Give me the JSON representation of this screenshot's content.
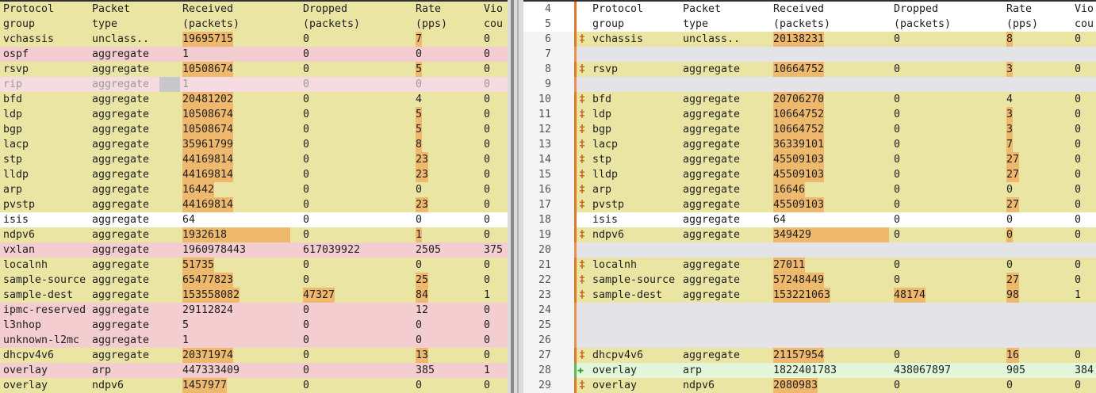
{
  "colors": {
    "yellow": "#ebe5a4",
    "pink": "#f4cdd0",
    "pink_light": "#f6dbe0",
    "white": "#ffffff",
    "grey": "#e3e3e8",
    "green": "#e2f7da",
    "highlight": "#eeb96c",
    "change_marker": "#e07a2b"
  },
  "icons": {
    "changed": "wavy-change-icon",
    "added": "plus-icon"
  },
  "headers": {
    "line1": [
      "Protocol",
      "Packet",
      "Received",
      "Dropped",
      "Rate",
      "Vio"
    ],
    "line2": [
      "group",
      "type",
      "(packets)",
      "(packets)",
      "(pps)",
      "cou"
    ]
  },
  "left": {
    "header_color": "yellow",
    "rows": [
      {
        "c": [
          "vchassis",
          "unclass..",
          "19695715",
          "0",
          "7",
          "0"
        ],
        "bg": "yellow",
        "hl": [
          2,
          4
        ]
      },
      {
        "c": [
          "ospf",
          "aggregate",
          "1",
          "0",
          "0",
          "0"
        ],
        "bg": "pink",
        "hl": []
      },
      {
        "c": [
          "rsvp",
          "aggregate",
          "10508674",
          "0",
          "5",
          "0"
        ],
        "bg": "yellow",
        "hl": [
          2,
          4
        ]
      },
      {
        "c": [
          "rip",
          "aggregate",
          "1",
          "0",
          "0",
          "0"
        ],
        "bg": "pink_light",
        "hl": [],
        "dim": true
      },
      {
        "c": [
          "bfd",
          "aggregate",
          "20481202",
          "0",
          "4",
          "0"
        ],
        "bg": "yellow",
        "hl": [
          2
        ]
      },
      {
        "c": [
          "ldp",
          "aggregate",
          "10508674",
          "0",
          "5",
          "0"
        ],
        "bg": "yellow",
        "hl": [
          2,
          4
        ]
      },
      {
        "c": [
          "bgp",
          "aggregate",
          "10508674",
          "0",
          "5",
          "0"
        ],
        "bg": "yellow",
        "hl": [
          2,
          4
        ]
      },
      {
        "c": [
          "lacp",
          "aggregate",
          "35961799",
          "0",
          "8",
          "0"
        ],
        "bg": "yellow",
        "hl": [
          2,
          4
        ]
      },
      {
        "c": [
          "stp",
          "aggregate",
          "44169814",
          "0",
          "23",
          "0"
        ],
        "bg": "yellow",
        "hl": [
          2,
          4
        ]
      },
      {
        "c": [
          "lldp",
          "aggregate",
          "44169814",
          "0",
          "23",
          "0"
        ],
        "bg": "yellow",
        "hl": [
          2,
          4
        ]
      },
      {
        "c": [
          "arp",
          "aggregate",
          "16442",
          "0",
          "0",
          "0"
        ],
        "bg": "yellow",
        "hl": [
          2
        ]
      },
      {
        "c": [
          "pvstp",
          "aggregate",
          "44169814",
          "0",
          "23",
          "0"
        ],
        "bg": "yellow",
        "hl": [
          2,
          4
        ]
      },
      {
        "c": [
          "isis",
          "aggregate",
          "64",
          "0",
          "0",
          "0"
        ],
        "bg": "white",
        "hl": []
      },
      {
        "c": [
          "ndpv6",
          "aggregate",
          "1932618",
          "0",
          "1",
          "0"
        ],
        "bg": "yellow",
        "hl": [
          2,
          4
        ]
      },
      {
        "c": [
          "vxlan",
          "aggregate",
          "1960978443",
          "617039922",
          "2505",
          "375"
        ],
        "bg": "pink",
        "hl": []
      },
      {
        "c": [
          "localnh",
          "aggregate",
          "51735",
          "0",
          "0",
          "0"
        ],
        "bg": "yellow",
        "hl": [
          2
        ]
      },
      {
        "c": [
          "sample-source",
          "aggregate",
          "65477823",
          "0",
          "25",
          "0"
        ],
        "bg": "yellow",
        "hl": [
          2,
          4
        ]
      },
      {
        "c": [
          "sample-dest",
          "aggregate",
          "153558082",
          "47327",
          "84",
          "1"
        ],
        "bg": "yellow",
        "hl": [
          2,
          3,
          4
        ]
      },
      {
        "c": [
          "ipmc-reserved",
          "aggregate",
          "29112824",
          "0",
          "12",
          "0"
        ],
        "bg": "pink",
        "hl": []
      },
      {
        "c": [
          "l3nhop",
          "aggregate",
          "5",
          "0",
          "0",
          "0"
        ],
        "bg": "pink",
        "hl": []
      },
      {
        "c": [
          "unknown-l2mc",
          "aggregate",
          "1",
          "0",
          "0",
          "0"
        ],
        "bg": "pink",
        "hl": []
      },
      {
        "c": [
          "dhcpv4v6",
          "aggregate",
          "20371974",
          "0",
          "13",
          "0"
        ],
        "bg": "yellow",
        "hl": [
          2,
          4
        ]
      },
      {
        "c": [
          "overlay",
          "arp",
          "447333409",
          "0",
          "385",
          "1"
        ],
        "bg": "pink",
        "hl": []
      },
      {
        "c": [
          "overlay",
          "ndpv6",
          "1457977",
          "0",
          "0",
          "0"
        ],
        "bg": "yellow",
        "hl": [
          2
        ]
      }
    ]
  },
  "right": {
    "header_nums": [
      "4",
      "5"
    ],
    "rows": [
      {
        "n": "6",
        "c": [
          "vchassis",
          "unclass..",
          "20138231",
          "0",
          "8",
          "0"
        ],
        "bg": "yellow",
        "hl": [
          2,
          4
        ],
        "mark": "changed"
      },
      {
        "n": "7",
        "c": null,
        "bg": "grey"
      },
      {
        "n": "8",
        "c": [
          "rsvp",
          "aggregate",
          "10664752",
          "0",
          "3",
          "0"
        ],
        "bg": "yellow",
        "hl": [
          2,
          4
        ],
        "mark": "changed"
      },
      {
        "n": "9",
        "c": null,
        "bg": "grey"
      },
      {
        "n": "10",
        "c": [
          "bfd",
          "aggregate",
          "20706270",
          "0",
          "4",
          "0"
        ],
        "bg": "yellow",
        "hl": [
          2
        ],
        "mark": "changed"
      },
      {
        "n": "11",
        "c": [
          "ldp",
          "aggregate",
          "10664752",
          "0",
          "3",
          "0"
        ],
        "bg": "yellow",
        "hl": [
          2,
          4
        ],
        "mark": "changed"
      },
      {
        "n": "12",
        "c": [
          "bgp",
          "aggregate",
          "10664752",
          "0",
          "3",
          "0"
        ],
        "bg": "yellow",
        "hl": [
          2,
          4
        ],
        "mark": "changed"
      },
      {
        "n": "13",
        "c": [
          "lacp",
          "aggregate",
          "36339101",
          "0",
          "7",
          "0"
        ],
        "bg": "yellow",
        "hl": [
          2,
          4
        ],
        "mark": "changed"
      },
      {
        "n": "14",
        "c": [
          "stp",
          "aggregate",
          "45509103",
          "0",
          "27",
          "0"
        ],
        "bg": "yellow",
        "hl": [
          2,
          4
        ],
        "mark": "changed"
      },
      {
        "n": "15",
        "c": [
          "lldp",
          "aggregate",
          "45509103",
          "0",
          "27",
          "0"
        ],
        "bg": "yellow",
        "hl": [
          2,
          4
        ],
        "mark": "changed"
      },
      {
        "n": "16",
        "c": [
          "arp",
          "aggregate",
          "16646",
          "0",
          "0",
          "0"
        ],
        "bg": "yellow",
        "hl": [
          2
        ],
        "mark": "changed"
      },
      {
        "n": "17",
        "c": [
          "pvstp",
          "aggregate",
          "45509103",
          "0",
          "27",
          "0"
        ],
        "bg": "yellow",
        "hl": [
          2,
          4
        ],
        "mark": "changed"
      },
      {
        "n": "18",
        "c": [
          "isis",
          "aggregate",
          "64",
          "0",
          "0",
          "0"
        ],
        "bg": "white",
        "hl": [],
        "mark": ""
      },
      {
        "n": "19",
        "c": [
          "ndpv6",
          "aggregate",
          "349429",
          "0",
          "0",
          "0"
        ],
        "bg": "yellow",
        "hl": [
          2,
          4
        ],
        "mark": "changed"
      },
      {
        "n": "20",
        "c": null,
        "bg": "grey"
      },
      {
        "n": "21",
        "c": [
          "localnh",
          "aggregate",
          "27011",
          "0",
          "0",
          "0"
        ],
        "bg": "yellow",
        "hl": [
          2
        ],
        "mark": "changed"
      },
      {
        "n": "22",
        "c": [
          "sample-source",
          "aggregate",
          "57248449",
          "0",
          "27",
          "0"
        ],
        "bg": "yellow",
        "hl": [
          2,
          4
        ],
        "mark": "changed"
      },
      {
        "n": "23",
        "c": [
          "sample-dest",
          "aggregate",
          "153221063",
          "48174",
          "98",
          "1"
        ],
        "bg": "yellow",
        "hl": [
          2,
          3,
          4
        ],
        "mark": "changed"
      },
      {
        "n": "24",
        "c": null,
        "bg": "grey"
      },
      {
        "n": "25",
        "c": null,
        "bg": "grey"
      },
      {
        "n": "26",
        "c": null,
        "bg": "grey"
      },
      {
        "n": "27",
        "c": [
          "dhcpv4v6",
          "aggregate",
          "21157954",
          "0",
          "16",
          "0"
        ],
        "bg": "yellow",
        "hl": [
          2,
          4
        ],
        "mark": "changed"
      },
      {
        "n": "28",
        "c": [
          "overlay",
          "arp",
          "1822401783",
          "438067897",
          "905",
          "384"
        ],
        "bg": "green",
        "hl": [],
        "mark": "added"
      },
      {
        "n": "29",
        "c": [
          "overlay",
          "ndpv6",
          "2080983",
          "0",
          "0",
          "0"
        ],
        "bg": "yellow",
        "hl": [
          2
        ],
        "mark": "changed"
      }
    ]
  }
}
